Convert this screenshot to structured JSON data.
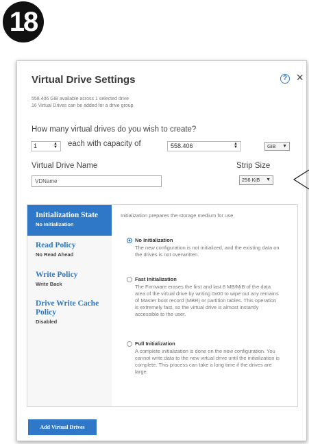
{
  "step": {
    "number": "18"
  },
  "dialog": {
    "title": "Virtual Drive Settings",
    "help": "?",
    "close": "×",
    "info_line1": "558.406 GiB available across 1 selected drive",
    "info_line2": "16 Virtual Drives can be added for a drive group",
    "question": "How many virtual drives do you wish to create?",
    "count_value": "1",
    "capacity_label": "each with capacity of",
    "capacity_value": "558.406",
    "unit_selected": "GiB",
    "vd_name_label": "Virtual Drive Name",
    "vd_name_value": "VDName",
    "strip_label": "Strip Size",
    "strip_selected": "256 KiB"
  },
  "tabs": [
    {
      "title": "Initialization State",
      "value": "No Initialization",
      "active": true
    },
    {
      "title": "Read Policy",
      "value": "No Read Ahead",
      "active": false
    },
    {
      "title": "Write Policy",
      "value": "Write Back",
      "active": false
    },
    {
      "title": "Drive Write Cache Policy",
      "value": "Disabled",
      "active": false
    }
  ],
  "init_content": {
    "intro": "Initialization prepares the storage medium for use",
    "options": [
      {
        "title": "No Initialization",
        "selected": true,
        "desc": "The new configuration is not initialized, and the existing data on the drives is not overwritten."
      },
      {
        "title": "Fast Initialization",
        "selected": false,
        "desc": "The Firmware erases the first and last 8 MB/MiB of the data area of the virtual drive by writing 0x00 to wipe out any remains of Master boot record (MBR) or partition tables. This operation is extremely fast, so the virtual drive is almost instantly accessible to the user."
      },
      {
        "title": "Full Initialization",
        "selected": false,
        "desc": "A complete initialization is done on the new configuration. You cannot write data to the new virtual drive until the initialization is complete. This process can take a long time if the drives are large."
      }
    ]
  },
  "footer": {
    "add_label": "Add Virtual Drives"
  },
  "colors": {
    "accent": "#2e78c7",
    "badge": "#111111"
  }
}
